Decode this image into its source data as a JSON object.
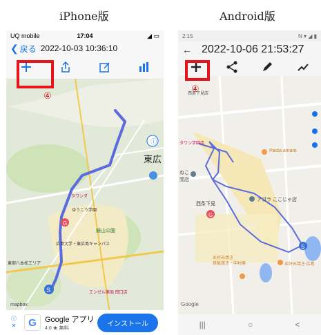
{
  "titles": {
    "ios": "iPhone版",
    "android": "Android版"
  },
  "ios": {
    "status": {
      "carrier": "UQ mobile",
      "time": "17:04"
    },
    "nav": {
      "back": "戻る",
      "date": "2022-10-03 10:36:10"
    },
    "toolbar": [
      "add-icon",
      "share-icon",
      "edit-icon",
      "chart-icon"
    ],
    "map_labels": {
      "city": "東広",
      "park": "鏡山公園",
      "univ": "広島大学・東広島キャンパス",
      "area": "東部八本松エリア",
      "school": "ゆうこう学園",
      "store": "タワンダ",
      "bottom": "エンゼル薬局 田口店",
      "corner": "mapbox"
    },
    "ad": {
      "name": "Google アプリ",
      "rating": "4.0 ★ 無料",
      "button": "インストール"
    },
    "step": "④"
  },
  "android": {
    "status": {
      "time": "2:15",
      "right": "N ▾ ◢ ▮"
    },
    "header": {
      "date": "2022-10-06 21:53:27"
    },
    "toolbar": [
      "add-icon",
      "share-icon",
      "edit-icon",
      "chart-icon"
    ],
    "map_labels": {
      "top": "西条下見店",
      "shop": "タワン学園店",
      "pasta": "Pasta amare",
      "nekot": "ねこ",
      "nekot2": "間店",
      "saijo": "西条下見",
      "agora": "アゴラ ここじゃ店",
      "okonomi": "お好み焼き",
      "okonomi2": "鉄板焼き・中村屋",
      "okonomi3": "お好み焼き 広島",
      "google": "Google"
    },
    "nav": {
      "recent": "|||",
      "home": "○",
      "back": "<"
    },
    "step": "④"
  },
  "colors": {
    "highlight": "#e8141b",
    "route": "#5b6bdc",
    "ios_accent": "#1a73e8"
  }
}
